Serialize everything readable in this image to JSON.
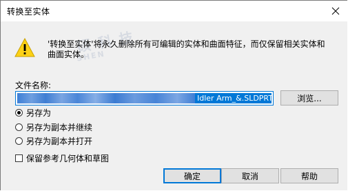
{
  "window": {
    "title": "转换至实体",
    "close_icon": "close-icon"
  },
  "message": {
    "icon": "warning-icon",
    "text": "'转换至实体'将永久删除所有可编辑的实体和曲面特征，而仅保留相关实体和曲面实体。"
  },
  "watermark": {
    "text": "硕 科 技",
    "sub": "SHEN"
  },
  "filename": {
    "label": "文件名称:",
    "value_visible": "Idler Arm_&.SLDPRT",
    "browse_label": "浏览..."
  },
  "options": [
    {
      "label": "另存为",
      "checked": true
    },
    {
      "label": "另存为副本并继续",
      "checked": false
    },
    {
      "label": "另存为副本并打开",
      "checked": false
    }
  ],
  "keep_reference": {
    "label": "保留参考几何体和草图",
    "checked": false
  },
  "buttons": {
    "ok": "确定",
    "cancel": "取消",
    "help": "帮助"
  },
  "colors": {
    "accent": "#0078d7",
    "warning_yellow": "#fcd116",
    "dialog_bg": "#f0f0f0"
  }
}
